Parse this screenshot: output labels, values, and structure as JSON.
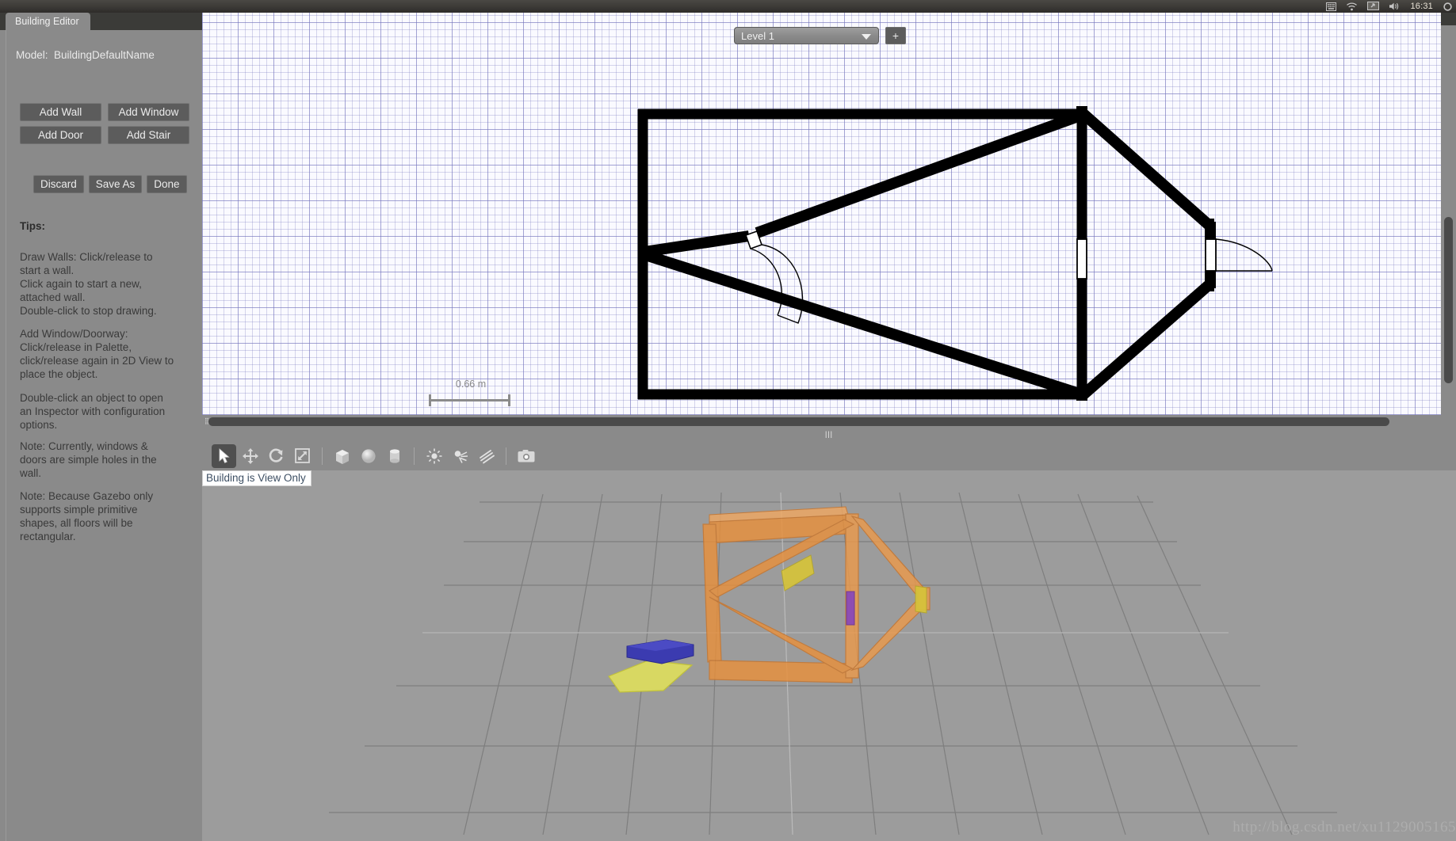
{
  "top_panel": {
    "clock": "16:31",
    "tray_icons": [
      "keyboard-icon",
      "wifi-icon",
      "display-icon",
      "volume-icon",
      "gear-icon"
    ]
  },
  "left_panel": {
    "tab_label": "Building Editor",
    "model_label": "Model:  BuildingDefaultName",
    "buttons": [
      {
        "label": "Add Wall",
        "name": "add-wall-button"
      },
      {
        "label": "Add Window",
        "name": "add-window-button"
      },
      {
        "label": "Add Door",
        "name": "add-door-button"
      },
      {
        "label": "Add Stair",
        "name": "add-stair-button"
      }
    ],
    "actions": [
      {
        "label": "Discard",
        "name": "discard-button"
      },
      {
        "label": "Save As",
        "name": "save-as-button"
      },
      {
        "label": "Done",
        "name": "done-button"
      }
    ],
    "tips_title": "Tips:",
    "tips": [
      "Draw Walls: Click/release to\nstart a wall.\nClick again to start a new,\nattached wall.\nDouble-click to stop drawing.",
      "Add Window/Doorway:\nClick/release in Palette,\nclick/release again in 2D View to\nplace the object.",
      "Double-click an object to open\nan Inspector with configuration\noptions.",
      "Note: Currently, windows &\ndoors are simple holes in the\nwall.",
      "Note: Because Gazebo only\nsupports simple primitive\nshapes, all floors will be\nrectangular."
    ]
  },
  "view2d": {
    "level_selected": "Level 1",
    "level_options": [
      "Level 1"
    ],
    "add_level_label": "+",
    "scale_label": "0.66 m"
  },
  "toolbar": {
    "tools": [
      {
        "name": "select-arrow-tool",
        "active": true
      },
      {
        "name": "translate-tool",
        "active": false
      },
      {
        "name": "rotate-tool",
        "active": false
      },
      {
        "name": "scale-tool",
        "active": false
      },
      {
        "name": "box-shape-tool",
        "active": false
      },
      {
        "name": "sphere-shape-tool",
        "active": false
      },
      {
        "name": "cylinder-shape-tool",
        "active": false
      },
      {
        "name": "point-light-tool",
        "active": false
      },
      {
        "name": "spot-light-tool",
        "active": false
      },
      {
        "name": "directional-light-tool",
        "active": false
      },
      {
        "name": "screenshot-camera-tool",
        "active": false
      }
    ]
  },
  "status": {
    "view_only_message": "Building is View Only"
  },
  "view3d": {
    "watermark": "http://blog.csdn.net/xu1129005165",
    "wall_color": "#e8903c",
    "door_color": "#d6c43a",
    "window_color": "#8a49b8",
    "ground_color": "#9c9c9c",
    "blue_box_color": "#3b3bb0",
    "yellow_plane_color": "#d8d862"
  }
}
